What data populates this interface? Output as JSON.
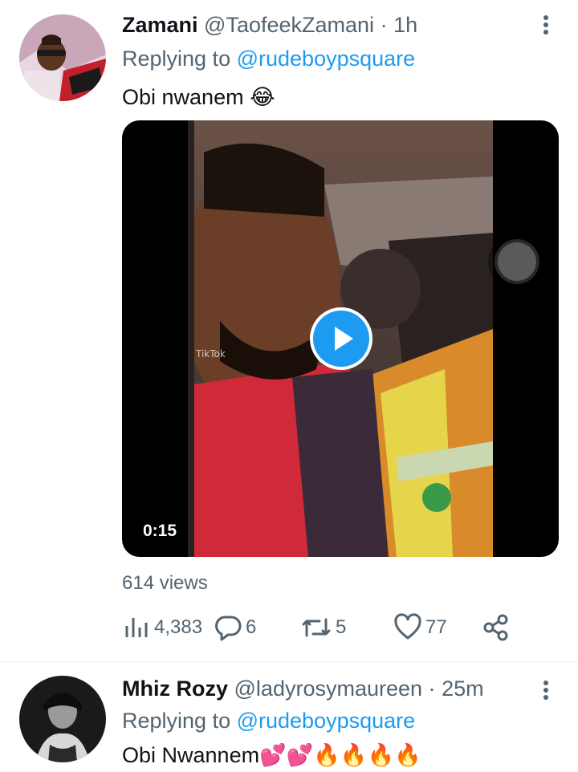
{
  "tweets": [
    {
      "display_name": "Zamani",
      "handle": "@TaofeekZamani",
      "separator": "·",
      "time": "1h",
      "reply_prefix": "Replying to",
      "reply_to": "@rudeboypsquare",
      "text": "Obi nwanem 😂",
      "media": {
        "duration": "0:15",
        "watermark": "TikTok"
      },
      "views": "614 views",
      "stats": {
        "views_count": "4,383",
        "replies": "6",
        "retweets": "5",
        "likes": "77"
      }
    },
    {
      "display_name": "Mhiz Rozy",
      "handle": "@ladyrosymaureen",
      "separator": "·",
      "time": "25m",
      "reply_prefix": "Replying to",
      "reply_to": "@rudeboypsquare",
      "text": "Obi Nwannem💕💕🔥🔥🔥🔥"
    }
  ],
  "colors": {
    "accent": "#1d9bf0",
    "secondary_text": "#536471",
    "primary_text": "#0f1419",
    "divider": "#eff3f4"
  },
  "icons": [
    "more-icon",
    "analytics-icon",
    "reply-icon",
    "retweet-icon",
    "like-icon",
    "share-icon",
    "play-icon"
  ]
}
